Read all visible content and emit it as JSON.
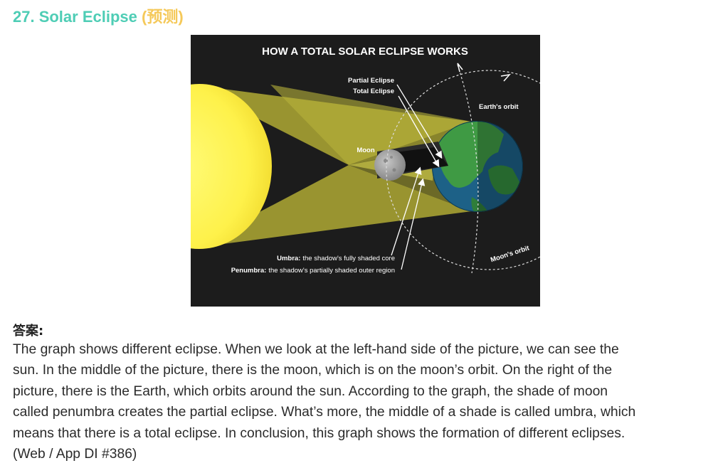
{
  "header": {
    "title": "27. Solar Eclipse",
    "tag": "(预测)"
  },
  "figure": {
    "heading": "HOW A TOTAL SOLAR ECLIPSE WORKS",
    "labels": {
      "partial": "Partial Eclipse",
      "total": "Total Eclipse",
      "earths_orbit": "Earth's orbit",
      "moon": "Moon",
      "moons_orbit": "Moon's orbit",
      "umbra_term": "Umbra:",
      "umbra_desc": "the shadow's fully shaded core",
      "penumbra_term": "Penumbra:",
      "penumbra_desc": "the shadow's partially shaded outer region"
    },
    "colors": {
      "background": "#1c1c1c",
      "sun": "#fef14a",
      "light_cone": "#a7a233",
      "earth_ocean": "#1d6187",
      "earth_land": "#3f9a44",
      "moon": "#9a9a9a"
    },
    "icons": [
      "sun",
      "moon",
      "earth",
      "arrow"
    ]
  },
  "answer": {
    "label": "答案:",
    "lines": [
      "The graph shows different eclipse. When we look at the left-hand side of the picture, we can see the",
      "sun. In the middle of the picture, there is the moon, which is on the moon’s orbit. On the right of the",
      "picture, there is the Earth, which orbits around the sun. According to the graph, the shade of moon",
      "called penumbra creates the partial eclipse. What’s more, the middle of a shade is called umbra, which",
      "means that there is a total eclipse. In conclusion, this graph shows the formation of different eclipses.",
      "(Web / App DI #386)"
    ]
  }
}
